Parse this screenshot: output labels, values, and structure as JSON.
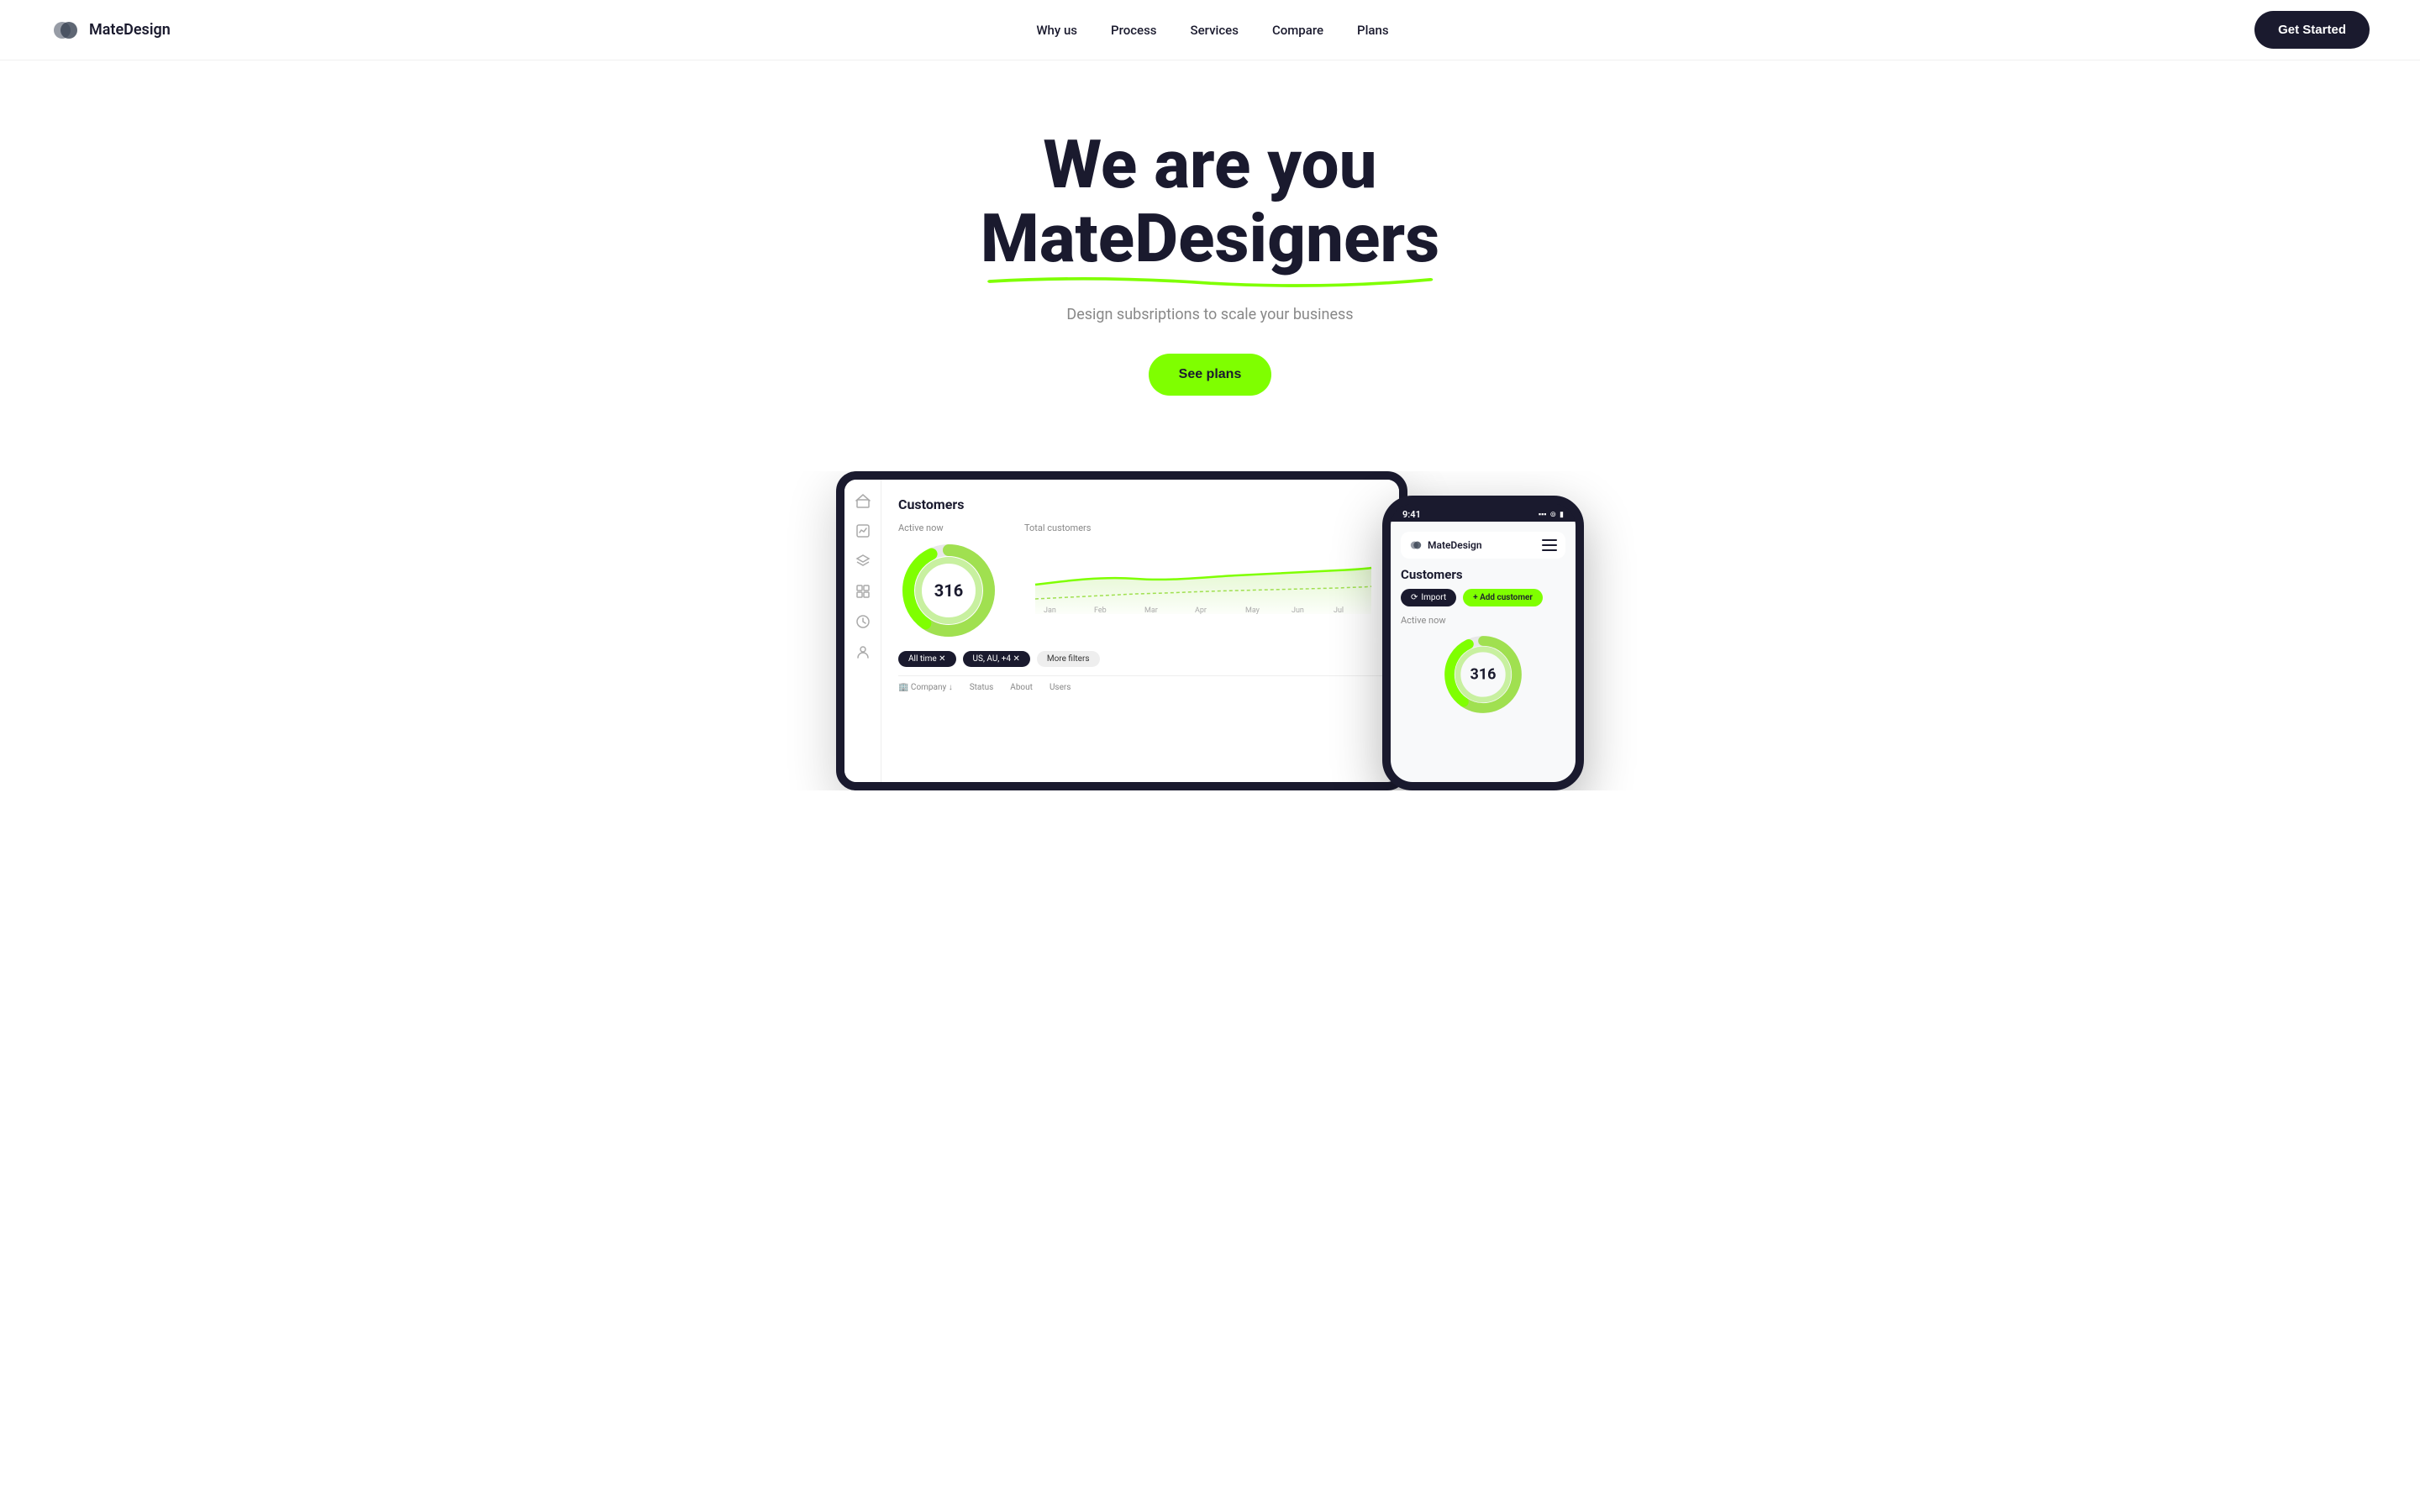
{
  "brand": {
    "name": "MateDesign",
    "logo_alt": "MateDesign logo"
  },
  "nav": {
    "links": [
      {
        "label": "Why us",
        "href": "#"
      },
      {
        "label": "Process",
        "href": "#"
      },
      {
        "label": "Services",
        "href": "#"
      },
      {
        "label": "Compare",
        "href": "#"
      },
      {
        "label": "Plans",
        "href": "#"
      }
    ],
    "cta": "Get Started"
  },
  "hero": {
    "line1": "We are you",
    "line2": "MateDesigners",
    "subtitle": "Design subsriptions to scale your business",
    "cta": "See plans"
  },
  "mockup": {
    "tablet": {
      "title": "Customers",
      "active_label": "Active now",
      "total_label": "Total customers",
      "number": "316",
      "filters": [
        "All time ✕",
        "US, AU, +4 ✕",
        "More filters"
      ],
      "table_cols": [
        "Company ↓",
        "Status",
        "About",
        "Users"
      ]
    },
    "phone": {
      "time": "9:41",
      "app_name": "MateDesign",
      "title": "Customers",
      "import_label": "Import",
      "add_label": "+ Add customer",
      "active_label": "Active now",
      "number": "316"
    }
  },
  "colors": {
    "accent": "#7fff00",
    "dark": "#1a1a2e",
    "text_muted": "#888888"
  }
}
